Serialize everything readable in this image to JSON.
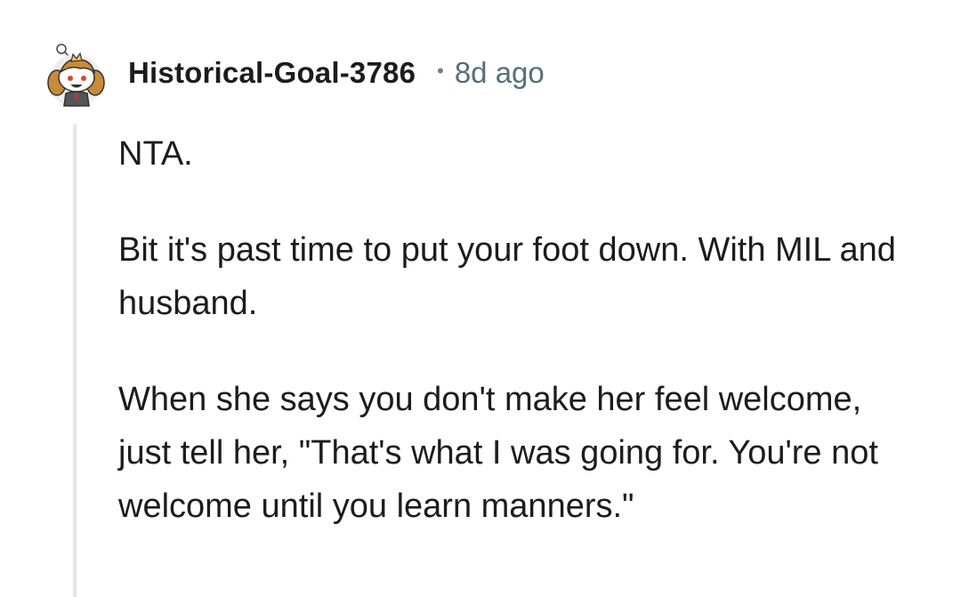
{
  "comment": {
    "author": "Historical-Goal-3786",
    "separator": "•",
    "timestamp": "8d ago",
    "avatar_icon": "snoo-avatar-icon",
    "paragraphs": [
      "NTA.",
      "Bit it's past time to put your foot down. With MIL and husband.",
      "When she says you don't make her feel welcome, just tell her, \"That's what I was going for. You're not welcome until you learn manners.\""
    ]
  },
  "colors": {
    "text": "#1c1c1c",
    "meta": "#576f76",
    "thread_line": "#e3e5e7",
    "background": "#ffffff"
  }
}
